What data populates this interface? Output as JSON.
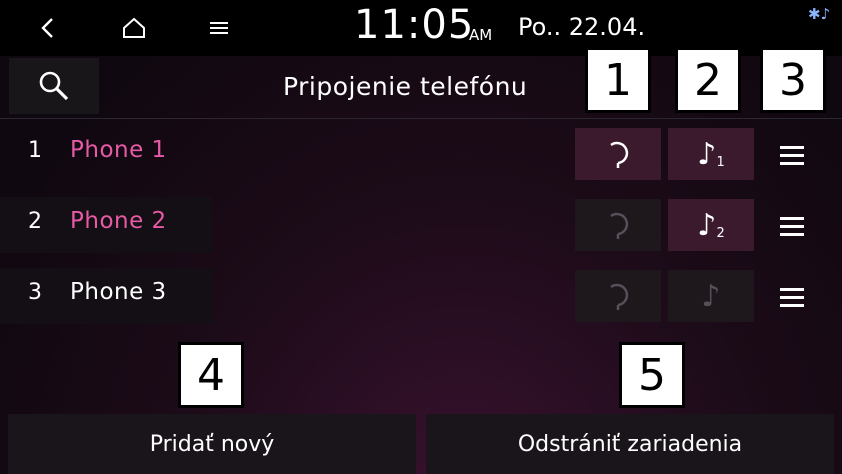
{
  "status_bar": {
    "time": "11:05",
    "ampm": "AM",
    "date": "Po.. 22.04.",
    "bluetooth_icon": "bluetooth-audio-icon"
  },
  "nav": {
    "back_icon": "back-arrow-icon",
    "home_icon": "home-icon",
    "menu_icon": "menu-icon"
  },
  "header": {
    "title": "Pripojenie telefónu",
    "search_icon": "search-icon"
  },
  "callouts": [
    "1",
    "2",
    "3",
    "4",
    "5"
  ],
  "devices": [
    {
      "index": "1",
      "name": "Phone 1",
      "connected": true,
      "audio_label": "♪",
      "audio_sub": "1"
    },
    {
      "index": "2",
      "name": "Phone 2",
      "connected": false,
      "audio_label": "♪",
      "audio_sub": "2"
    },
    {
      "index": "3",
      "name": "Phone 3",
      "connected": false,
      "audio_label": "♪",
      "audio_sub": ""
    }
  ],
  "footer": {
    "add_label": "Pridať nový",
    "remove_label": "Odstrániť zariadenia"
  },
  "colors": {
    "active_name": "#e65aa6",
    "inactive_name": "#ffffff",
    "active_button_bg": "#3a1a2c",
    "inactive_button_bg": "#1e171c"
  }
}
